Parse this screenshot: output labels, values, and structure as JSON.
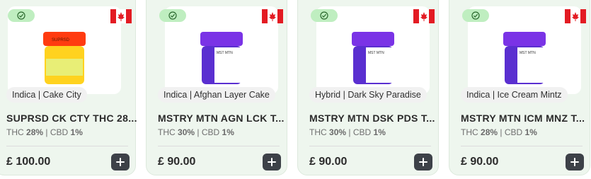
{
  "currency_symbol": "£",
  "products": [
    {
      "category": "Indica | Cake City",
      "name": "SUPRSD CK CTY THC 28...",
      "thc_label": "THC",
      "thc_value": "28%",
      "separator": "|",
      "cbd_label": "CBD",
      "cbd_value": "1%",
      "price": "£ 100.00",
      "jar_lid_color": "#ff3b10",
      "jar_body_color": "#ffd21f",
      "jar_label_color": "#e8ee76",
      "jar_brand": "SUPRSD"
    },
    {
      "category": "Indica | Afghan Layer Cake",
      "name": "MSTRY MTN AGN LCK T...",
      "thc_label": "THC",
      "thc_value": "30%",
      "separator": "|",
      "cbd_label": "CBD",
      "cbd_value": "1%",
      "price": "£ 90.00",
      "jar_lid_color": "#7a33e6",
      "jar_body_color": "#5a2fd0",
      "jar_label_color": "#ffffff",
      "jar_brand": "MST MTN"
    },
    {
      "category": "Hybrid | Dark Sky Paradise",
      "name": "MSTRY MTN DSK PDS T...",
      "thc_label": "THC",
      "thc_value": "30%",
      "separator": "|",
      "cbd_label": "CBD",
      "cbd_value": "1%",
      "price": "£ 90.00",
      "jar_lid_color": "#7a33e6",
      "jar_body_color": "#5a2fd0",
      "jar_label_color": "#ffffff",
      "jar_brand": "MST MTN"
    },
    {
      "category": "Indica | Ice Cream Mintz",
      "name": "MSTRY MTN ICM MNZ T...",
      "thc_label": "THC",
      "thc_value": "28%",
      "separator": "|",
      "cbd_label": "CBD",
      "cbd_value": "1%",
      "price": "£ 90.00",
      "jar_lid_color": "#7a33e6",
      "jar_body_color": "#5a2fd0",
      "jar_label_color": "#ffffff",
      "jar_brand": "MST MTN"
    }
  ],
  "icons": {
    "verified": "check-circle-icon",
    "origin_flag": "canada-flag-icon",
    "add": "plus-icon"
  },
  "colors": {
    "card_bg": "#eef6ee",
    "verified_pill": "#bfeec0",
    "button_bg": "#3d4148",
    "flag_red": "#e31b23"
  }
}
